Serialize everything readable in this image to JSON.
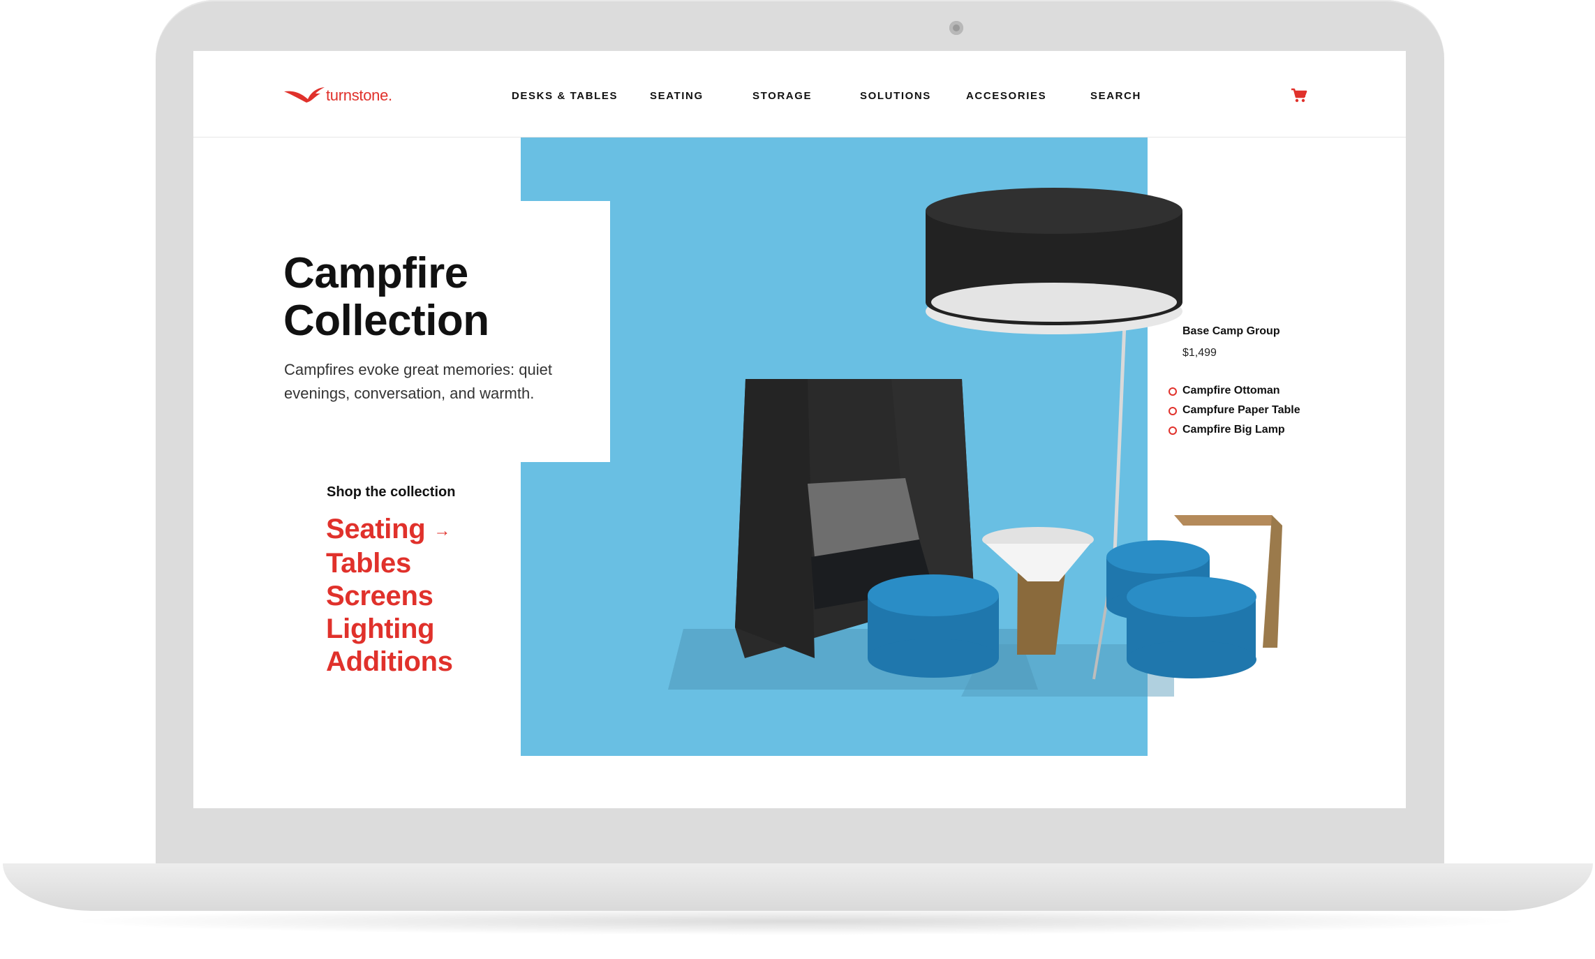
{
  "brand": {
    "name": "turnstone.",
    "accent": "#e0312b"
  },
  "nav": {
    "items": [
      "DESKS & TABLES",
      "SEATING",
      "STORAGE",
      "SOLUTIONS",
      "ACCESORIES",
      "SEARCH"
    ],
    "cart_icon": "cart-icon"
  },
  "hero": {
    "title": "Campfire Collection",
    "description": "Campfires evoke great memories: quiet evenings, conversation, and warmth.",
    "background": "#69bfe3"
  },
  "shop": {
    "heading": "Shop the collection",
    "categories": [
      "Seating",
      "Tables",
      "Screens",
      "Lighting",
      "Additions"
    ],
    "arrow_icon": "arrow-right-icon"
  },
  "product_group": {
    "name": "Base Camp Group",
    "price": "$1,499",
    "items": [
      "Campfire Ottoman",
      "Campfure Paper Table",
      "Campfire Big Lamp"
    ]
  }
}
